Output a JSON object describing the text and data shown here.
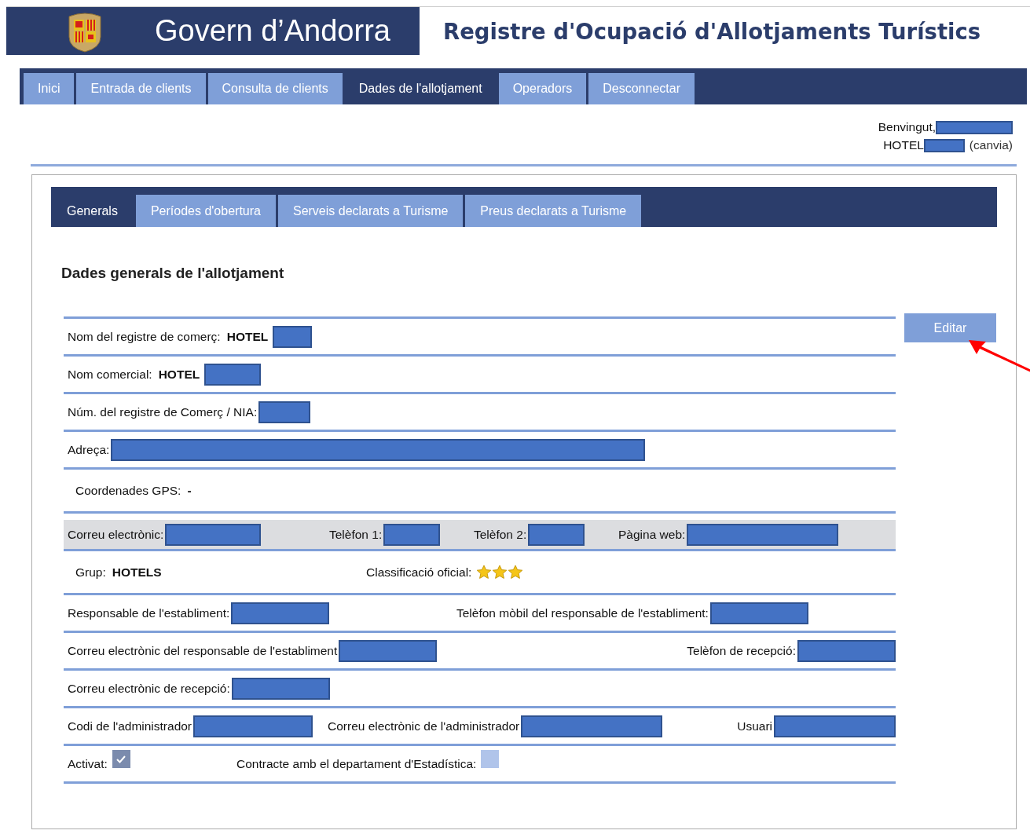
{
  "header": {
    "brand": "Govern d’Andorra",
    "title": "Registre d'Ocupació d'Allotjaments Turístics"
  },
  "nav": [
    {
      "label": "Inici",
      "selected": false
    },
    {
      "label": "Entrada de clients",
      "selected": false
    },
    {
      "label": "Consulta de clients",
      "selected": false
    },
    {
      "label": "Dades de l'allotjament",
      "selected": true
    },
    {
      "label": "Operadors",
      "selected": false
    },
    {
      "label": "Desconnectar",
      "selected": false
    }
  ],
  "user": {
    "greeting": "Benvingut,",
    "greeting_redacted": true,
    "hotel": "HOTEL",
    "hotel_redacted": true,
    "change_link": "(canvia)"
  },
  "tabs": [
    {
      "label": "Generals",
      "selected": true
    },
    {
      "label": "Períodes d'obertura",
      "selected": false
    },
    {
      "label": "Serveis declarats a Turisme",
      "selected": false
    },
    {
      "label": "Preus declarats a Turisme",
      "selected": false
    }
  ],
  "section_title": "Dades generals de l'allotjament",
  "edit_button": "Editar",
  "rows": [
    {
      "shaded": false,
      "fields": [
        {
          "kind": "text",
          "label": "Nom del registre de comerç:",
          "value": "HOTEL",
          "redacted": true
        }
      ]
    },
    {
      "shaded": false,
      "fields": [
        {
          "kind": "text",
          "label": "Nom comercial:",
          "value": "HOTEL",
          "redacted": true
        }
      ]
    },
    {
      "shaded": false,
      "fields": [
        {
          "kind": "text",
          "label": "Núm. del registre de Comerç / NIA:",
          "redacted": true
        }
      ]
    },
    {
      "shaded": false,
      "fields": [
        {
          "kind": "text",
          "label": "Adreça:",
          "redacted": true
        }
      ]
    },
    {
      "shaded": false,
      "fields": [
        {
          "kind": "text",
          "label": "Coordenades GPS:",
          "value": "-"
        }
      ]
    },
    {
      "shaded": true,
      "fields": [
        {
          "kind": "text",
          "label": "Correu electrònic:",
          "redacted": true
        },
        {
          "kind": "text",
          "label": "Telèfon 1:",
          "redacted": true
        },
        {
          "kind": "text",
          "label": "Telèfon 2:",
          "redacted": true
        },
        {
          "kind": "text",
          "label": "Pàgina web:",
          "redacted": true
        }
      ]
    },
    {
      "shaded": false,
      "fields": [
        {
          "kind": "text",
          "label": "Grup:",
          "value": "HOTELS"
        },
        {
          "kind": "stars",
          "label": "Classificació oficial:",
          "stars": 3
        }
      ]
    },
    {
      "shaded": false,
      "fields": [
        {
          "kind": "text",
          "label": "Responsable de l'establiment:",
          "redacted": true
        },
        {
          "kind": "text",
          "label": "Telèfon mòbil del responsable de l'establiment:",
          "redacted": true
        }
      ]
    },
    {
      "shaded": false,
      "fields": [
        {
          "kind": "text",
          "label": "Correu electrònic del responsable de l'establiment",
          "redacted": true
        },
        {
          "kind": "text",
          "label": "Telèfon de recepció:",
          "redacted": true
        }
      ]
    },
    {
      "shaded": false,
      "fields": [
        {
          "kind": "text",
          "label": "Correu electrònic de recepció:",
          "redacted": true
        }
      ]
    },
    {
      "shaded": false,
      "fields": [
        {
          "kind": "text",
          "label": "Codi de l'administrador",
          "redacted": true
        },
        {
          "kind": "text",
          "label": "Correu electrònic de l'administrador",
          "redacted": true
        },
        {
          "kind": "text",
          "label": "Usuari",
          "redacted": true
        }
      ]
    },
    {
      "shaded": false,
      "fields": [
        {
          "kind": "checkbox",
          "label": "Activat:",
          "checked": true
        },
        {
          "kind": "checkbox",
          "label": "Contracte amb el departament d'Estadística:",
          "checked": false
        }
      ]
    }
  ]
}
